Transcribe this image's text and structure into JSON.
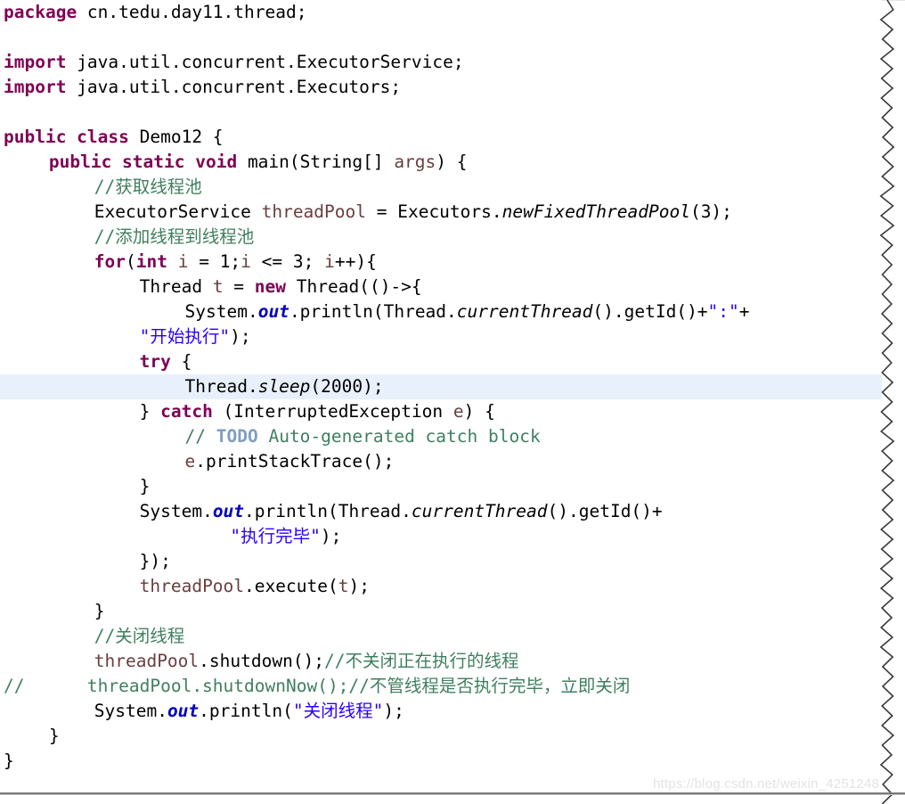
{
  "editor": {
    "language": "java",
    "class_name": "Demo12",
    "package": "cn.tedu.day11.thread",
    "highlighted_line_number": 13,
    "colors": {
      "background": "#ffffff",
      "keyword": "#7f0055",
      "comment": "#3f7f5f",
      "comment_todo": "#7f9fbf",
      "string": "#2a00ff",
      "static_field": "#0000c0",
      "local_variable": "#6a3e3e",
      "plain_text": "#000000",
      "line_highlight": "#e8f0fb",
      "watermark": "#e3e3e3"
    }
  },
  "watermark": {
    "text": "https://blog.csdn.net/weixin_4251248"
  },
  "code": {
    "lines": [
      {
        "n": 1,
        "indent": 0,
        "highlight": false,
        "tokens": [
          {
            "t": "package",
            "c": "kw"
          },
          {
            "t": " cn.tedu.day11.thread;",
            "c": "plain"
          }
        ]
      },
      {
        "n": 2,
        "indent": 0,
        "highlight": false,
        "tokens": []
      },
      {
        "n": 3,
        "indent": 0,
        "highlight": false,
        "tokens": [
          {
            "t": "import",
            "c": "kw"
          },
          {
            "t": " java.util.concurrent.ExecutorService;",
            "c": "plain"
          }
        ]
      },
      {
        "n": 4,
        "indent": 0,
        "highlight": false,
        "tokens": [
          {
            "t": "import",
            "c": "kw"
          },
          {
            "t": " java.util.concurrent.Executors;",
            "c": "plain"
          }
        ]
      },
      {
        "n": 5,
        "indent": 0,
        "highlight": false,
        "tokens": []
      },
      {
        "n": 6,
        "indent": 0,
        "highlight": false,
        "tokens": [
          {
            "t": "public class",
            "c": "kw"
          },
          {
            "t": " Demo12 {",
            "c": "plain"
          }
        ]
      },
      {
        "n": 7,
        "indent": 4,
        "highlight": false,
        "tokens": [
          {
            "t": "public static void",
            "c": "kw"
          },
          {
            "t": " main(String[] ",
            "c": "plain"
          },
          {
            "t": "args",
            "c": "lvar"
          },
          {
            "t": ") {",
            "c": "plain"
          }
        ]
      },
      {
        "n": 8,
        "indent": 8,
        "highlight": false,
        "tokens": [
          {
            "t": "//获取线程池",
            "c": "cmt"
          }
        ]
      },
      {
        "n": 9,
        "indent": 8,
        "highlight": false,
        "tokens": [
          {
            "t": "ExecutorService ",
            "c": "plain"
          },
          {
            "t": "threadPool",
            "c": "lvar"
          },
          {
            "t": " = Executors.",
            "c": "plain"
          },
          {
            "t": "newFixedThreadPool",
            "c": "stat"
          },
          {
            "t": "(3);",
            "c": "plain"
          }
        ]
      },
      {
        "n": 10,
        "indent": 8,
        "highlight": false,
        "tokens": [
          {
            "t": "//添加线程到线程池",
            "c": "cmt"
          }
        ]
      },
      {
        "n": 11,
        "indent": 8,
        "highlight": false,
        "tokens": [
          {
            "t": "for",
            "c": "kw"
          },
          {
            "t": "(",
            "c": "plain"
          },
          {
            "t": "int",
            "c": "kw"
          },
          {
            "t": " ",
            "c": "plain"
          },
          {
            "t": "i",
            "c": "lvar"
          },
          {
            "t": " = 1;",
            "c": "plain"
          },
          {
            "t": "i",
            "c": "lvar"
          },
          {
            "t": " <= 3; ",
            "c": "plain"
          },
          {
            "t": "i",
            "c": "lvar"
          },
          {
            "t": "++){",
            "c": "plain"
          }
        ]
      },
      {
        "n": 12,
        "indent": 12,
        "highlight": false,
        "tokens": [
          {
            "t": "Thread ",
            "c": "plain"
          },
          {
            "t": "t",
            "c": "lvar"
          },
          {
            "t": " = ",
            "c": "plain"
          },
          {
            "t": "new",
            "c": "kw"
          },
          {
            "t": " Thread(()->{",
            "c": "plain"
          }
        ]
      },
      {
        "n": 13,
        "indent": 16,
        "highlight": false,
        "tokens": [
          {
            "t": "System.",
            "c": "plain"
          },
          {
            "t": "out",
            "c": "fld"
          },
          {
            "t": ".println(Thread.",
            "c": "plain"
          },
          {
            "t": "currentThread",
            "c": "stat"
          },
          {
            "t": "().getId()+",
            "c": "plain"
          },
          {
            "t": "\":\"",
            "c": "str"
          },
          {
            "t": "+",
            "c": "plain"
          }
        ]
      },
      {
        "n": 14,
        "indent": 12,
        "highlight": false,
        "tokens": [
          {
            "t": "\"开始执行\"",
            "c": "str"
          },
          {
            "t": ");",
            "c": "plain"
          }
        ]
      },
      {
        "n": 15,
        "indent": 12,
        "highlight": false,
        "tokens": [
          {
            "t": "try",
            "c": "kw"
          },
          {
            "t": " {",
            "c": "plain"
          }
        ]
      },
      {
        "n": 16,
        "indent": 16,
        "highlight": true,
        "tokens": [
          {
            "t": "Thread.",
            "c": "plain"
          },
          {
            "t": "sleep",
            "c": "stat"
          },
          {
            "t": "(2000);",
            "c": "plain"
          }
        ]
      },
      {
        "n": 17,
        "indent": 12,
        "highlight": false,
        "tokens": [
          {
            "t": "} ",
            "c": "plain"
          },
          {
            "t": "catch",
            "c": "kw"
          },
          {
            "t": " (InterruptedException ",
            "c": "plain"
          },
          {
            "t": "e",
            "c": "lvar"
          },
          {
            "t": ") {",
            "c": "plain"
          }
        ]
      },
      {
        "n": 18,
        "indent": 16,
        "highlight": false,
        "tokens": [
          {
            "t": "// ",
            "c": "cmt"
          },
          {
            "t": "TODO",
            "c": "cmt-todo"
          },
          {
            "t": " Auto-generated catch block",
            "c": "cmt"
          }
        ]
      },
      {
        "n": 19,
        "indent": 16,
        "highlight": false,
        "tokens": [
          {
            "t": "e",
            "c": "lvar"
          },
          {
            "t": ".printStackTrace();",
            "c": "plain"
          }
        ]
      },
      {
        "n": 20,
        "indent": 12,
        "highlight": false,
        "tokens": [
          {
            "t": "}",
            "c": "plain"
          }
        ]
      },
      {
        "n": 21,
        "indent": 12,
        "highlight": false,
        "tokens": [
          {
            "t": "System.",
            "c": "plain"
          },
          {
            "t": "out",
            "c": "fld"
          },
          {
            "t": ".println(Thread.",
            "c": "plain"
          },
          {
            "t": "currentThread",
            "c": "stat"
          },
          {
            "t": "().getId()+",
            "c": "plain"
          }
        ]
      },
      {
        "n": 22,
        "indent": 20,
        "highlight": false,
        "tokens": [
          {
            "t": "\"执行完毕\"",
            "c": "str"
          },
          {
            "t": ");",
            "c": "plain"
          }
        ]
      },
      {
        "n": 23,
        "indent": 12,
        "highlight": false,
        "tokens": [
          {
            "t": "});",
            "c": "plain"
          }
        ]
      },
      {
        "n": 24,
        "indent": 12,
        "highlight": false,
        "tokens": [
          {
            "t": "threadPool",
            "c": "lvar"
          },
          {
            "t": ".execute(",
            "c": "plain"
          },
          {
            "t": "t",
            "c": "lvar"
          },
          {
            "t": ");",
            "c": "plain"
          }
        ]
      },
      {
        "n": 25,
        "indent": 8,
        "highlight": false,
        "tokens": [
          {
            "t": "}",
            "c": "plain"
          }
        ]
      },
      {
        "n": 26,
        "indent": 8,
        "highlight": false,
        "tokens": [
          {
            "t": "//关闭线程",
            "c": "cmt"
          }
        ]
      },
      {
        "n": 27,
        "indent": 8,
        "highlight": false,
        "tokens": [
          {
            "t": "threadPool",
            "c": "lvar"
          },
          {
            "t": ".shutdown();",
            "c": "plain"
          },
          {
            "t": "//不关闭正在执行的线程",
            "c": "cmt"
          }
        ]
      },
      {
        "n": 28,
        "indent": 0,
        "highlight": false,
        "tokens": [
          {
            "t": "//      threadPool.shutdownNow();//不管线程是否执行完毕，立即关闭",
            "c": "cmt"
          }
        ]
      },
      {
        "n": 29,
        "indent": 8,
        "highlight": false,
        "tokens": [
          {
            "t": "System.",
            "c": "plain"
          },
          {
            "t": "out",
            "c": "fld"
          },
          {
            "t": ".println(",
            "c": "plain"
          },
          {
            "t": "\"关闭线程\"",
            "c": "str"
          },
          {
            "t": ");",
            "c": "plain"
          }
        ]
      },
      {
        "n": 30,
        "indent": 4,
        "highlight": false,
        "tokens": [
          {
            "t": "}",
            "c": "plain"
          }
        ]
      },
      {
        "n": 31,
        "indent": 0,
        "highlight": false,
        "tokens": [
          {
            "t": "}",
            "c": "plain"
          }
        ]
      },
      {
        "n": 32,
        "indent": 0,
        "highlight": false,
        "tokens": []
      }
    ]
  }
}
